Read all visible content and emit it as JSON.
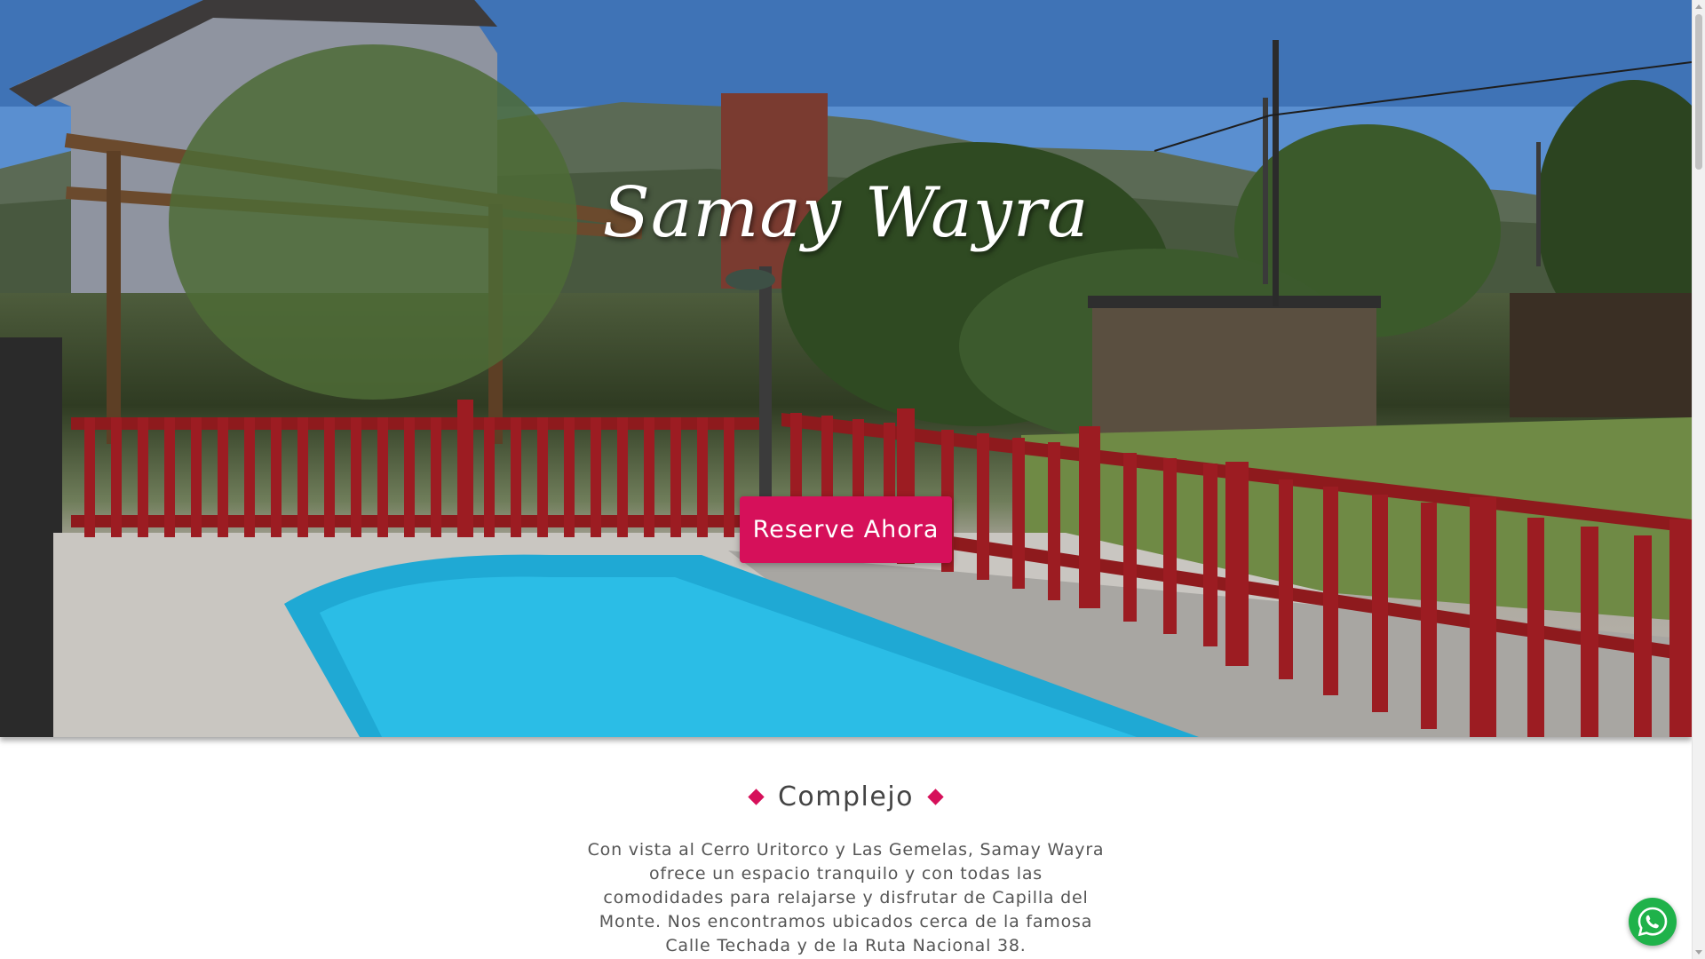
{
  "hero": {
    "title": "Samay Wayra",
    "cta_label": "Reserve Ahora"
  },
  "complejo": {
    "heading": "Complejo",
    "description": "Con vista al Cerro Uritorco y Las Gemelas, Samay Wayra ofrece un espacio tranquilo y con todas las comodidades para relajarse y disfrutar de Capilla del Monte. Nos encontramos ubicados cerca de la famosa Calle Techada y de la Ruta Nacional 38."
  },
  "whatsapp": {
    "icon": "whatsapp-icon",
    "color": "#1fb24a"
  },
  "colors": {
    "accent": "#d6105a",
    "text": "#555555",
    "heading": "#444444"
  }
}
